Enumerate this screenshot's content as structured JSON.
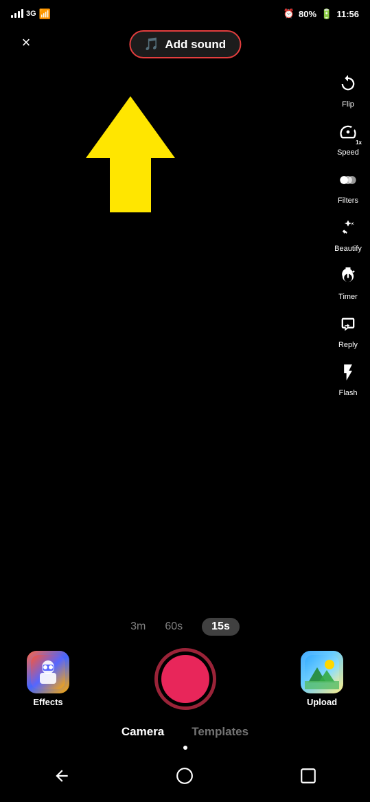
{
  "statusBar": {
    "signal": "3G",
    "battery": "80%",
    "time": "11:56"
  },
  "header": {
    "closeLabel": "×",
    "addSoundLabel": "Add sound"
  },
  "rightControls": [
    {
      "id": "flip",
      "label": "Flip"
    },
    {
      "id": "speed",
      "label": "Speed"
    },
    {
      "id": "filters",
      "label": "Filters"
    },
    {
      "id": "beautify",
      "label": "Beautify"
    },
    {
      "id": "timer",
      "label": "Timer"
    },
    {
      "id": "reply",
      "label": "Reply"
    },
    {
      "id": "flash",
      "label": "Flash"
    }
  ],
  "duration": {
    "options": [
      "3m",
      "60s",
      "15s"
    ],
    "active": "15s"
  },
  "bottomBar": {
    "effectsLabel": "Effects",
    "uploadLabel": "Upload",
    "tabs": [
      "Camera",
      "Templates"
    ],
    "activeTab": "Camera"
  },
  "navBar": {
    "back": "back",
    "home": "home",
    "square": "square"
  }
}
